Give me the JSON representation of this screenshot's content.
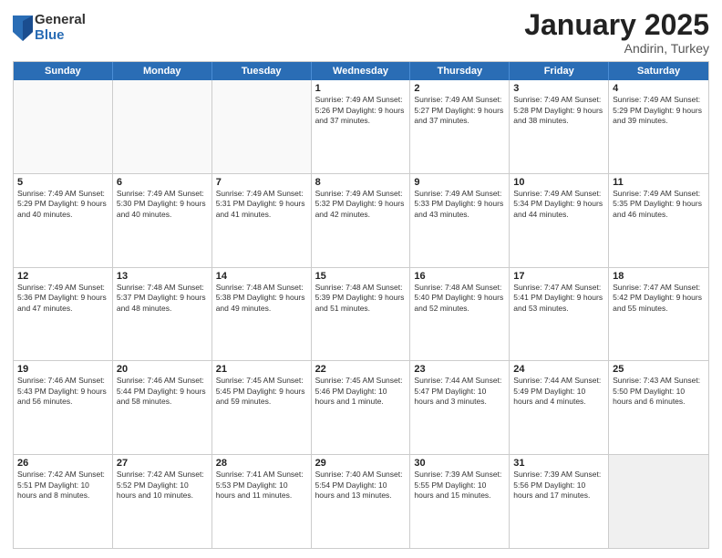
{
  "logo": {
    "general": "General",
    "blue": "Blue"
  },
  "title": "January 2025",
  "subtitle": "Andirin, Turkey",
  "days": [
    "Sunday",
    "Monday",
    "Tuesday",
    "Wednesday",
    "Thursday",
    "Friday",
    "Saturday"
  ],
  "rows": [
    [
      {
        "day": "",
        "text": "",
        "empty": true
      },
      {
        "day": "",
        "text": "",
        "empty": true
      },
      {
        "day": "",
        "text": "",
        "empty": true
      },
      {
        "day": "1",
        "text": "Sunrise: 7:49 AM\nSunset: 5:26 PM\nDaylight: 9 hours and 37 minutes."
      },
      {
        "day": "2",
        "text": "Sunrise: 7:49 AM\nSunset: 5:27 PM\nDaylight: 9 hours and 37 minutes."
      },
      {
        "day": "3",
        "text": "Sunrise: 7:49 AM\nSunset: 5:28 PM\nDaylight: 9 hours and 38 minutes."
      },
      {
        "day": "4",
        "text": "Sunrise: 7:49 AM\nSunset: 5:29 PM\nDaylight: 9 hours and 39 minutes."
      }
    ],
    [
      {
        "day": "5",
        "text": "Sunrise: 7:49 AM\nSunset: 5:29 PM\nDaylight: 9 hours and 40 minutes."
      },
      {
        "day": "6",
        "text": "Sunrise: 7:49 AM\nSunset: 5:30 PM\nDaylight: 9 hours and 40 minutes."
      },
      {
        "day": "7",
        "text": "Sunrise: 7:49 AM\nSunset: 5:31 PM\nDaylight: 9 hours and 41 minutes."
      },
      {
        "day": "8",
        "text": "Sunrise: 7:49 AM\nSunset: 5:32 PM\nDaylight: 9 hours and 42 minutes."
      },
      {
        "day": "9",
        "text": "Sunrise: 7:49 AM\nSunset: 5:33 PM\nDaylight: 9 hours and 43 minutes."
      },
      {
        "day": "10",
        "text": "Sunrise: 7:49 AM\nSunset: 5:34 PM\nDaylight: 9 hours and 44 minutes."
      },
      {
        "day": "11",
        "text": "Sunrise: 7:49 AM\nSunset: 5:35 PM\nDaylight: 9 hours and 46 minutes."
      }
    ],
    [
      {
        "day": "12",
        "text": "Sunrise: 7:49 AM\nSunset: 5:36 PM\nDaylight: 9 hours and 47 minutes."
      },
      {
        "day": "13",
        "text": "Sunrise: 7:48 AM\nSunset: 5:37 PM\nDaylight: 9 hours and 48 minutes."
      },
      {
        "day": "14",
        "text": "Sunrise: 7:48 AM\nSunset: 5:38 PM\nDaylight: 9 hours and 49 minutes."
      },
      {
        "day": "15",
        "text": "Sunrise: 7:48 AM\nSunset: 5:39 PM\nDaylight: 9 hours and 51 minutes."
      },
      {
        "day": "16",
        "text": "Sunrise: 7:48 AM\nSunset: 5:40 PM\nDaylight: 9 hours and 52 minutes."
      },
      {
        "day": "17",
        "text": "Sunrise: 7:47 AM\nSunset: 5:41 PM\nDaylight: 9 hours and 53 minutes."
      },
      {
        "day": "18",
        "text": "Sunrise: 7:47 AM\nSunset: 5:42 PM\nDaylight: 9 hours and 55 minutes."
      }
    ],
    [
      {
        "day": "19",
        "text": "Sunrise: 7:46 AM\nSunset: 5:43 PM\nDaylight: 9 hours and 56 minutes."
      },
      {
        "day": "20",
        "text": "Sunrise: 7:46 AM\nSunset: 5:44 PM\nDaylight: 9 hours and 58 minutes."
      },
      {
        "day": "21",
        "text": "Sunrise: 7:45 AM\nSunset: 5:45 PM\nDaylight: 9 hours and 59 minutes."
      },
      {
        "day": "22",
        "text": "Sunrise: 7:45 AM\nSunset: 5:46 PM\nDaylight: 10 hours and 1 minute."
      },
      {
        "day": "23",
        "text": "Sunrise: 7:44 AM\nSunset: 5:47 PM\nDaylight: 10 hours and 3 minutes."
      },
      {
        "day": "24",
        "text": "Sunrise: 7:44 AM\nSunset: 5:49 PM\nDaylight: 10 hours and 4 minutes."
      },
      {
        "day": "25",
        "text": "Sunrise: 7:43 AM\nSunset: 5:50 PM\nDaylight: 10 hours and 6 minutes."
      }
    ],
    [
      {
        "day": "26",
        "text": "Sunrise: 7:42 AM\nSunset: 5:51 PM\nDaylight: 10 hours and 8 minutes."
      },
      {
        "day": "27",
        "text": "Sunrise: 7:42 AM\nSunset: 5:52 PM\nDaylight: 10 hours and 10 minutes."
      },
      {
        "day": "28",
        "text": "Sunrise: 7:41 AM\nSunset: 5:53 PM\nDaylight: 10 hours and 11 minutes."
      },
      {
        "day": "29",
        "text": "Sunrise: 7:40 AM\nSunset: 5:54 PM\nDaylight: 10 hours and 13 minutes."
      },
      {
        "day": "30",
        "text": "Sunrise: 7:39 AM\nSunset: 5:55 PM\nDaylight: 10 hours and 15 minutes."
      },
      {
        "day": "31",
        "text": "Sunrise: 7:39 AM\nSunset: 5:56 PM\nDaylight: 10 hours and 17 minutes."
      },
      {
        "day": "",
        "text": "",
        "empty": true,
        "shaded": true
      }
    ]
  ]
}
